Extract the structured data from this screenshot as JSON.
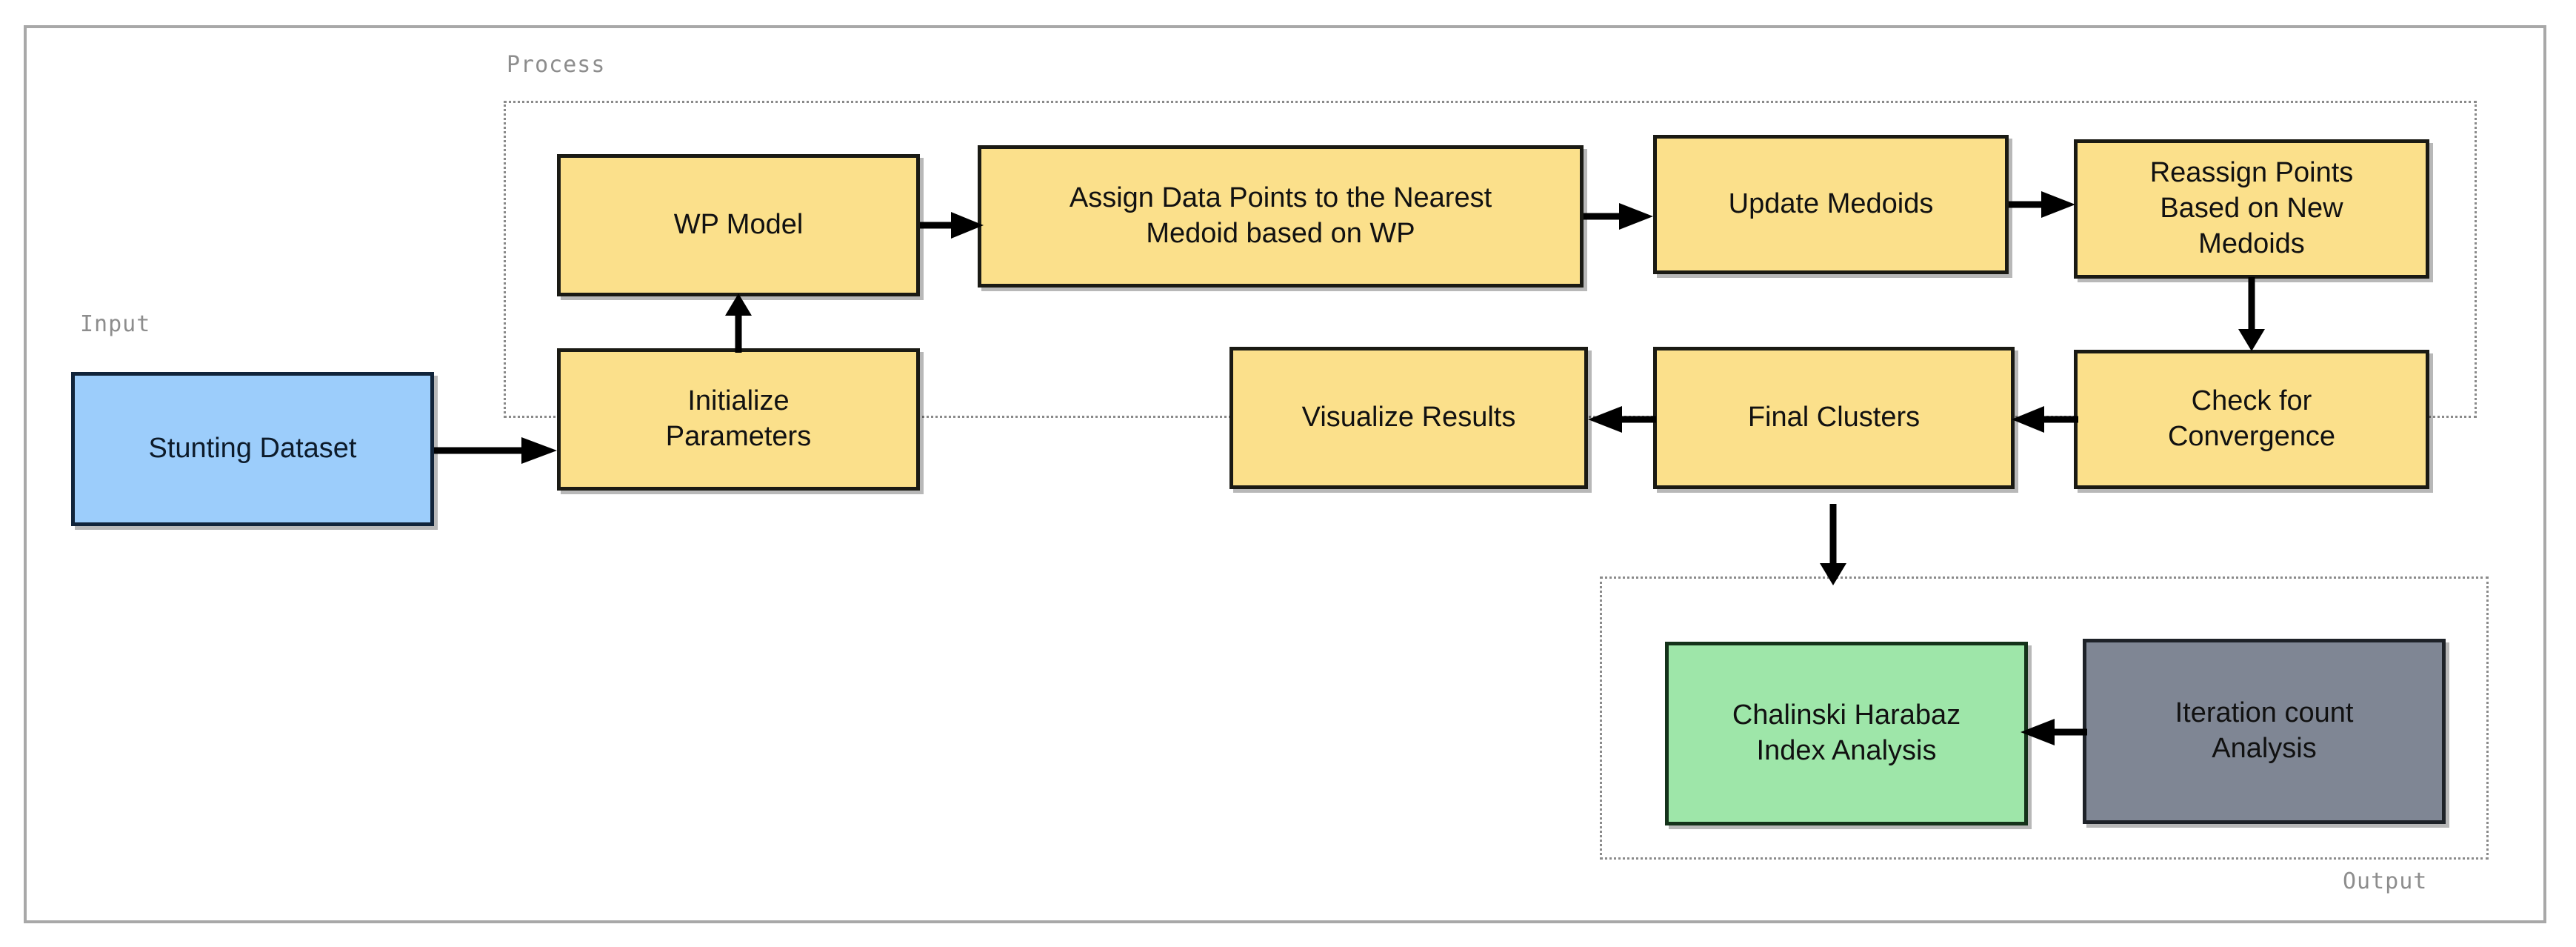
{
  "diagram": {
    "title_groups": {
      "input": "Input",
      "process": "Process",
      "output": "Output"
    },
    "colors": {
      "yellow_fill": "#fbe08b",
      "blue_fill": "#9ccdfb",
      "green_fill": "#9ee6a9",
      "gray_fill": "#7f8694",
      "node_border": "#1a1a14",
      "group_border": "#8a8a8a",
      "frame_border": "#a8a8a8",
      "label_text": "#8d8d8d",
      "arrow": "#000000"
    },
    "nodes": {
      "stunting_dataset": "Stunting Dataset",
      "wp_model": "WP Model",
      "initialize_parameters": "Initialize\nParameters",
      "initialize_parameters_line1": "Initialize",
      "initialize_parameters_line2": "Parameters",
      "assign_points_line1": "Assign Data Points to the Nearest",
      "assign_points_line2": "Medoid based on WP",
      "update_medoids": "Update Medoids",
      "reassign_line1": "Reassign Points",
      "reassign_line2": "Based on New",
      "reassign_line3": "Medoids",
      "check_convergence_line1": "Check for",
      "check_convergence_line2": "Convergence",
      "final_clusters": "Final Clusters",
      "visualize_results": "Visualize Results",
      "chalinski_line1": "Chalinski Harabaz",
      "chalinski_line2": "Index Analysis",
      "iteration_line1": "Iteration count",
      "iteration_line2": "Analysis"
    },
    "edges": [
      {
        "from": "stunting_dataset",
        "to": "wp_model",
        "direction": "right"
      },
      {
        "from": "initialize_parameters",
        "to": "wp_model",
        "direction": "up"
      },
      {
        "from": "wp_model",
        "to": "assign_points",
        "direction": "right"
      },
      {
        "from": "assign_points",
        "to": "update_medoids",
        "direction": "right"
      },
      {
        "from": "update_medoids",
        "to": "reassign",
        "direction": "right"
      },
      {
        "from": "reassign",
        "to": "check_convergence",
        "direction": "down"
      },
      {
        "from": "check_convergence",
        "to": "final_clusters",
        "direction": "left"
      },
      {
        "from": "final_clusters",
        "to": "visualize_results",
        "direction": "left"
      },
      {
        "from": "final_clusters",
        "to": "output_group",
        "direction": "down"
      },
      {
        "from": "iteration_count_analysis",
        "to": "chalinski_harabaz",
        "direction": "left"
      }
    ]
  }
}
